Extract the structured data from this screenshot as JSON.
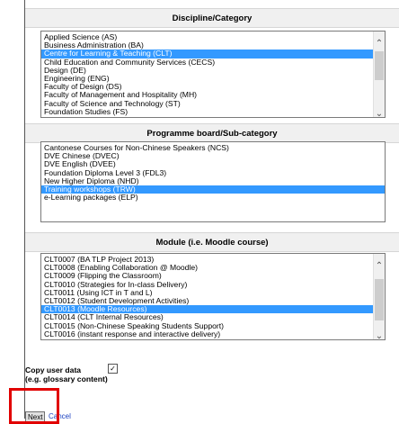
{
  "discipline": {
    "header": "Discipline/Category",
    "options": [
      "Applied Science (AS)",
      "Business Administration (BA)",
      "Centre for Learning & Teaching (CLT)",
      "Child Education and Community Services (CECS)",
      "Design (DE)",
      "Engineering (ENG)",
      "Faculty of Design (DS)",
      "Faculty of Management and Hospitality (MH)",
      "Faculty of Science and Technology (ST)",
      "Foundation Studies (FS)"
    ],
    "selected": "Centre for Learning & Teaching (CLT)"
  },
  "programme": {
    "header": "Programme board/Sub-category",
    "options": [
      "Cantonese Courses for Non-Chinese Speakers (NCS)",
      "DVE Chinese (DVEC)",
      "DVE English (DVEE)",
      "Foundation Diploma Level 3 (FDL3)",
      "New Higher Diploma (NHD)",
      "Training workshops (TRW)",
      "e-Learning packages (ELP)"
    ],
    "selected": "Training workshops (TRW)"
  },
  "module": {
    "header": "Module (i.e. Moodle course)",
    "options": [
      "CLT0007 (BA TLP Project 2013)",
      "CLT0008 (Enabling Collaboration @ Moodle)",
      "CLT0009 (Flipping the Classroom)",
      "CLT0010 (Strategies for In-class Delivery)",
      "CLT0011 (Using ICT in T and L)",
      "CLT0012 (Student Development Activities)",
      "CLT0013 (Moodle Resources)",
      "CLT0014 (CLT Internal Resources)",
      "CLT0015 (Non-Chinese Speaking Students Support)",
      "CLT0016 (instant response and interactive delivery)"
    ],
    "selected": "CLT0013 (Moodle Resources)"
  },
  "copy_user_data": {
    "label_line1": "Copy user data",
    "label_line2": "(e.g. glossary content)",
    "checked": true,
    "check_glyph": "✓"
  },
  "actions": {
    "next_label": "Next",
    "cancel_label": "Cancel"
  },
  "scroll": {
    "up_glyph": "⌃",
    "down_glyph": "⌄"
  }
}
